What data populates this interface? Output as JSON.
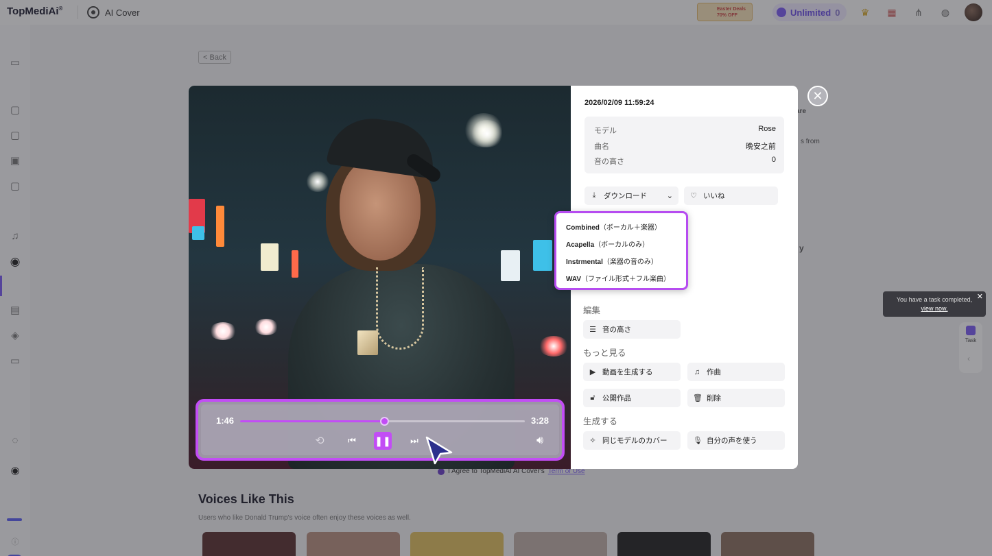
{
  "app": {
    "logo": "TopMediAi",
    "logo_mark": "®",
    "page_name": "AI Cover",
    "promo_line1": "Easter Deals",
    "promo_line2": "70% OFF",
    "plan_label": "Unlimited",
    "plan_count": "0"
  },
  "background": {
    "back_label": "< Back",
    "share_frag": "are",
    "from_frag": "s from",
    "y_frag": "y",
    "agree_text": "I Agree to TopMediAI AI Cover's ",
    "agree_link": "Term of Use",
    "voices_title": "Voices Like This",
    "voices_sub": "Users who like Donald Trump's voice often enjoy these voices as well."
  },
  "toast": {
    "text": "You have a task completed,",
    "link": "view now."
  },
  "task_widget": {
    "label": "Task"
  },
  "modal": {
    "date": "2026/02/09 11:59:24",
    "meta": [
      {
        "key": "モデル",
        "value": "Rose"
      },
      {
        "key": "曲名",
        "value": "晩安之前"
      },
      {
        "key": "音の高さ",
        "value": "0"
      }
    ],
    "download_label": "ダウンロード",
    "like_label": "いいね",
    "download_options": [
      {
        "title": "Combined",
        "note": "（ボーカル＋楽器）"
      },
      {
        "title": "Acapella",
        "note": "（ボーカルのみ）"
      },
      {
        "title": "Instrmental",
        "note": "（楽器の音のみ）"
      },
      {
        "title": "WAV",
        "note": "（ファイル形式＋フル楽曲）"
      }
    ],
    "edit_title": "編集",
    "pitch_label": "音の高さ",
    "more_title": "もっと見る",
    "gen_video_label": "動画を生成する",
    "compose_label": "作曲",
    "public_label": "公開作品",
    "delete_label": "削除",
    "generate_title": "生成する",
    "same_model_label": "同じモデルのカバー",
    "own_voice_label": "自分の声を使う"
  },
  "player": {
    "current_time": "1:46",
    "duration": "3:28",
    "progress": 0.505
  },
  "colors": {
    "accent": "#c24df5",
    "brand": "#7b5cf5"
  }
}
